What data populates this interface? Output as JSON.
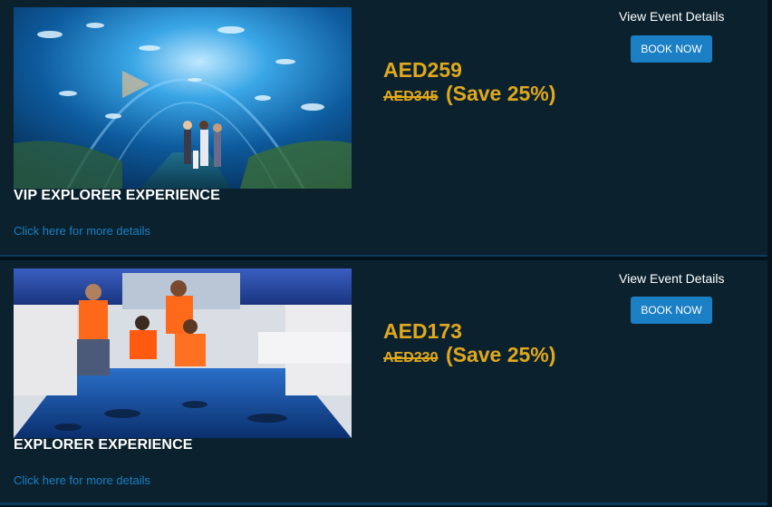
{
  "events": [
    {
      "title": "VIP EXPLORER EXPERIENCE",
      "more_link": "Click here for more details",
      "price_now": "AED259",
      "price_was": "AED345",
      "save_text": "(Save 25%)",
      "view_details": "View Event Details",
      "book_label": "BOOK NOW",
      "image": "aquarium-tunnel-photo"
    },
    {
      "title": "EXPLORER EXPERIENCE",
      "more_link": "Click here for more details",
      "price_now": "AED173",
      "price_was": "AED230",
      "save_text": "(Save 25%)",
      "view_details": "View Event Details",
      "book_label": "BOOK NOW",
      "image": "glass-bottom-boat-photo"
    }
  ],
  "colors": {
    "page_bg": "#06141c",
    "card_bg": "#0b222e",
    "price": "#e0a81c",
    "link": "#1a7fc4",
    "button": "#1a7fc4"
  }
}
